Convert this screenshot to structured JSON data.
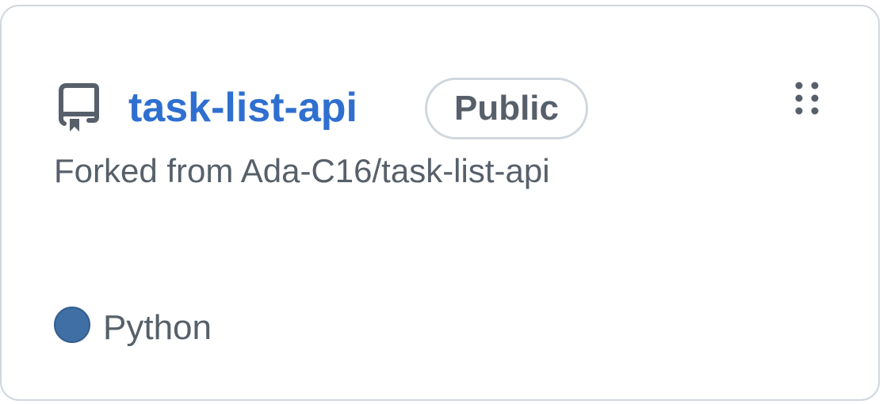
{
  "repo": {
    "name": "task-list-api",
    "visibility": "Public",
    "forked_from": "Forked from Ada-C16/task-list-api",
    "language": "Python",
    "language_color": "#3f6fa5",
    "icon": "repo-icon",
    "drag_icon": "drag-handle-icon"
  },
  "colors": {
    "link": "#2f6fd0",
    "muted": "#57606a",
    "border": "#d0d7de"
  }
}
